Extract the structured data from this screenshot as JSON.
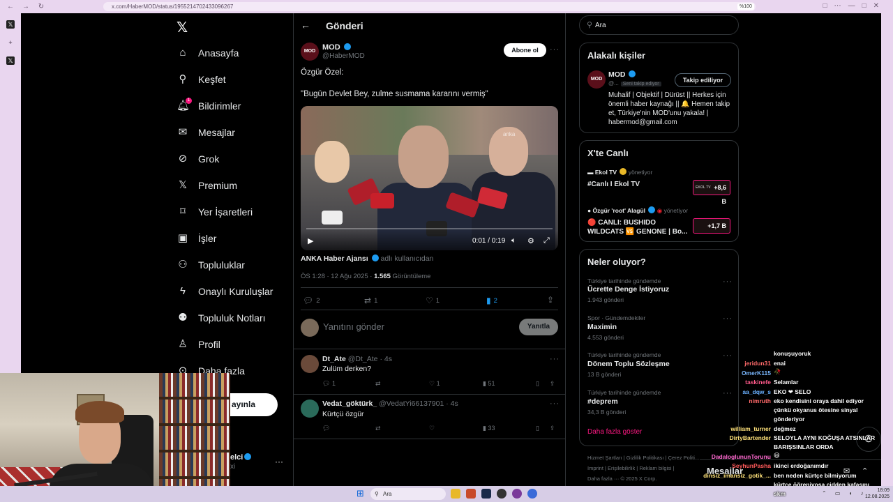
{
  "browser": {
    "url": "x.com/HaberMOD/status/1955214702433096267",
    "zoom": "%100"
  },
  "nav": {
    "items": [
      {
        "label": "Anasayfa",
        "icon": "home-icon"
      },
      {
        "label": "Keşfet",
        "icon": "search-icon"
      },
      {
        "label": "Bildirimler",
        "icon": "bell-icon",
        "badge": "1"
      },
      {
        "label": "Mesajlar",
        "icon": "mail-icon"
      },
      {
        "label": "Grok",
        "icon": "grok-icon"
      },
      {
        "label": "Premium",
        "icon": "x-logo-icon"
      },
      {
        "label": "Yer İşaretleri",
        "icon": "bookmark-icon"
      },
      {
        "label": "İşler",
        "icon": "briefcase-icon"
      },
      {
        "label": "Topluluklar",
        "icon": "people-icon"
      },
      {
        "label": "Onaylı Kuruluşlar",
        "icon": "lightning-icon"
      },
      {
        "label": "Topluluk Notları",
        "icon": "community-notes-icon"
      },
      {
        "label": "Profil",
        "icon": "person-icon"
      },
      {
        "label": "Daha fazla",
        "icon": "more-circle-icon"
      }
    ],
    "post_button_fragment": "ayınla",
    "account_name_fragment": "elci",
    "account_sub_fragment": "xi"
  },
  "header": {
    "title": "Gönderi"
  },
  "tweet": {
    "author": "MOD",
    "handle": "@HaberMOD",
    "avatar_text": "MOD",
    "follow_label": "Abone ol",
    "line1": "Özgür Özel:",
    "line2": "\"Bugün Devlet Bey, zulme susmama kararını vermiş\"",
    "video_time": "0:01 / 0:19",
    "video_watermark": "anka",
    "source_name": "ANKA Haber Ajansı",
    "source_suffix": "adlı kullanıcıdan",
    "time_date": "ÖS 1:28 · 12 Ağu 2025 ·",
    "views": "1.565",
    "views_label": "Görüntüleme",
    "replies": "2",
    "reposts": "1",
    "likes": "1",
    "bookmarks": "2"
  },
  "reply_box": {
    "placeholder": "Yanıtını gönder",
    "button": "Yanıtla"
  },
  "replies": [
    {
      "name": "Dt_Ate",
      "handle": "@Dt_Ate · 4s",
      "text": "Zulüm derken?",
      "replies": "1",
      "likes": "1",
      "views": "51"
    },
    {
      "name": "Vedat_göktürk_",
      "handle": "@VedatYi66137901 · 4s",
      "text": "Kürtçü özgür",
      "views": "33"
    }
  ],
  "search": {
    "value": "Ara"
  },
  "related": {
    "title": "Alakalı kişiler",
    "name": "MOD",
    "handle": "@...",
    "tag": "Seni takip ediyor",
    "button": "Takip ediliyor",
    "bio": "Muhalif | Objektif | Dürüst || Herkes için önemli haber kaynağı || 🔔 Hemen takip et, Türkiye'nin MOD'unu yakala! | habermod@gmail.com"
  },
  "live": {
    "title": "X'te Canlı",
    "items": [
      {
        "host": "Ekol TV",
        "role": "yönetiyor",
        "title": "#Canlı I Ekol TV",
        "badge": "+8,6 B",
        "badge_label": "EKOL TV"
      },
      {
        "host": "Özgür 'root' Alagül",
        "role": "yönetiyor",
        "title_line1": "🔴 CANLI: BUSHIDO",
        "title_line2": "WILDCATS 🆚 GENONE | Bo...",
        "badge": "+1,7 B"
      }
    ]
  },
  "trends": {
    "title": "Neler oluyor?",
    "items": [
      {
        "category": "Türkiye tarihinde gündemde",
        "name": "Ücrette Denge İstiyoruz",
        "count": "1.943 gönderi"
      },
      {
        "category": "Spor · Gündemdekiler",
        "name": "Maximin",
        "count": "4.553 gönderi"
      },
      {
        "category": "Türkiye tarihinde gündemde",
        "name": "Dönem Toplu Sözleşme",
        "count": "13 B gönderi"
      },
      {
        "category": "Türkiye tarihinde gündemde",
        "name": "#deprem",
        "count": "34,3 B gönderi"
      }
    ],
    "show_more": "Daha fazla göster"
  },
  "footer": {
    "row1": "Hizmet Şartları  |  Gizlilik Politikası  |  Çerez Politi...",
    "row2": "Imprint  |  Erişilebilirlik  |  Reklam bilgisi  |",
    "row3": "Daha fazla ···   © 2025 X Corp."
  },
  "chat": {
    "lines": [
      {
        "user": "",
        "text": "konuşuyoruk",
        "color": "#ffffff"
      },
      {
        "user": "jeridun31",
        "text": "enai",
        "color": "#ff6a6a"
      },
      {
        "user": "",
        "text": "🥀",
        "color": "#ffffff"
      },
      {
        "user": "OmerK115",
        "text": "",
        "color": "#7ab8ff"
      },
      {
        "user": "taskinefe",
        "text": "Selamlar",
        "color": "#ff5a8a"
      },
      {
        "user": "aa_dqw_s",
        "text": "EKO ❤ SELO",
        "color": "#6ab0ff"
      },
      {
        "user": "nimruth",
        "text": "eko kendisini oraya dahil ediyor",
        "color": "#ff6a6a"
      },
      {
        "user": "",
        "text": "çünkü okyanus ötesine sinyal",
        "color": "#ffffff"
      },
      {
        "user": "",
        "text": "gönderiyor",
        "color": "#ffffff"
      },
      {
        "user": "william_turner",
        "text": "değmez",
        "color": "#ffe27a"
      },
      {
        "user": "DirtyBartender",
        "text": "SELOYLA AYNI KOĞUŞA ATSINLAR",
        "color": "#ffe27a"
      },
      {
        "user": "",
        "text": "BARIŞSINLAR ORDA",
        "color": "#ffffff"
      },
      {
        "user": "",
        "text": "😄",
        "color": "#ffffff"
      },
      {
        "user": "DadaloglununTorunu",
        "text": "",
        "color": "#ff6ad0"
      },
      {
        "user": "SeyhunPasha",
        "text": "ikinci erdoğanımdır",
        "color": "#ff5a5a"
      },
      {
        "user": "dinsiz_imansiz_gotik_...",
        "text": "ben neden kürtçe bilmiyorum",
        "color": "#ffe27a"
      },
      {
        "user": "",
        "text": "kürtçe öğreniyosa cidden kafasını",
        "color": "#ffffff"
      },
      {
        "user": "",
        "text": "skm",
        "color": "#ffffff"
      }
    ]
  },
  "messages_bar": {
    "title": "Mesajlar"
  },
  "taskbar": {
    "search_text": "Ara",
    "time": "18:09",
    "date": "12.08.2025"
  },
  "colors": {
    "accent": "#1d9bf0",
    "pink": "#f91880",
    "bg": "#000000",
    "text": "#e7e9ea",
    "muted": "#71767b",
    "border": "#2f3336"
  }
}
